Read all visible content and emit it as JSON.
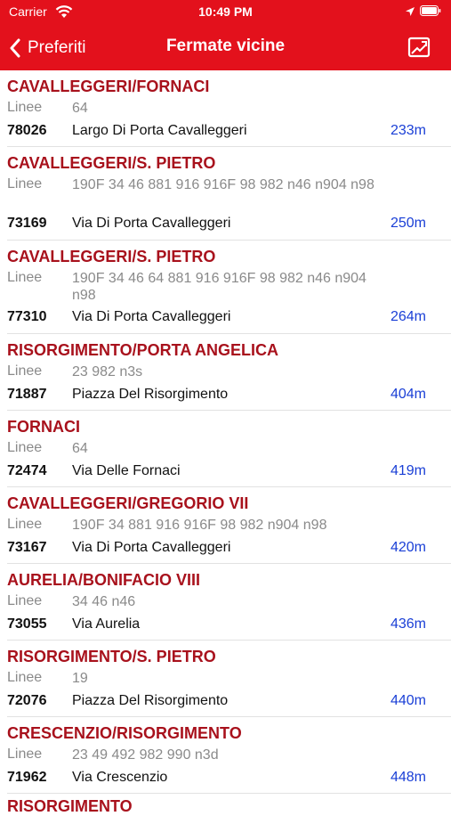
{
  "status_bar": {
    "carrier": "Carrier",
    "time": "10:49 PM"
  },
  "nav": {
    "back_label": "Preferiti",
    "title": "Fermate vicine"
  },
  "lines_label": "Linee",
  "stops": [
    {
      "name": "CAVALLEGGERI/FORNACI",
      "lines": "64",
      "code": "78026",
      "street": "Largo Di Porta Cavalleggeri",
      "distance": "233m"
    },
    {
      "name": "CAVALLEGGERI/S. PIETRO",
      "lines": "190F 34 46 881 916 916F 98 982 n46 n904 n98",
      "code": "73169",
      "street": "Via Di Porta Cavalleggeri",
      "distance": "250m"
    },
    {
      "name": "CAVALLEGGERI/S. PIETRO",
      "lines": "190F 34 46 64 881 916 916F 98 982 n46 n904 n98",
      "code": "77310",
      "street": "Via Di Porta Cavalleggeri",
      "distance": "264m"
    },
    {
      "name": "RISORGIMENTO/PORTA ANGELICA",
      "lines": "23 982 n3s",
      "code": "71887",
      "street": "Piazza Del Risorgimento",
      "distance": "404m"
    },
    {
      "name": "FORNACI",
      "lines": "64",
      "code": "72474",
      "street": "Via Delle Fornaci",
      "distance": "419m"
    },
    {
      "name": "CAVALLEGGERI/GREGORIO VII",
      "lines": "190F 34 881 916 916F 98 982 n904 n98",
      "code": "73167",
      "street": "Via Di Porta Cavalleggeri",
      "distance": "420m"
    },
    {
      "name": "AURELIA/BONIFACIO VIII",
      "lines": "34 46 n46",
      "code": "73055",
      "street": "Via Aurelia",
      "distance": "436m"
    },
    {
      "name": "RISORGIMENTO/S. PIETRO",
      "lines": "19",
      "code": "72076",
      "street": "Piazza Del Risorgimento",
      "distance": "440m"
    },
    {
      "name": "CRESCENZIO/RISORGIMENTO",
      "lines": "23 49 492 982 990 n3d",
      "code": "71962",
      "street": "Via Crescenzio",
      "distance": "448m"
    }
  ],
  "partial_stop_name": "RISORGIMENTO",
  "colors": {
    "bar": "#e3111c",
    "stop_name": "#a8111c",
    "distance": "#1a3fd6"
  }
}
